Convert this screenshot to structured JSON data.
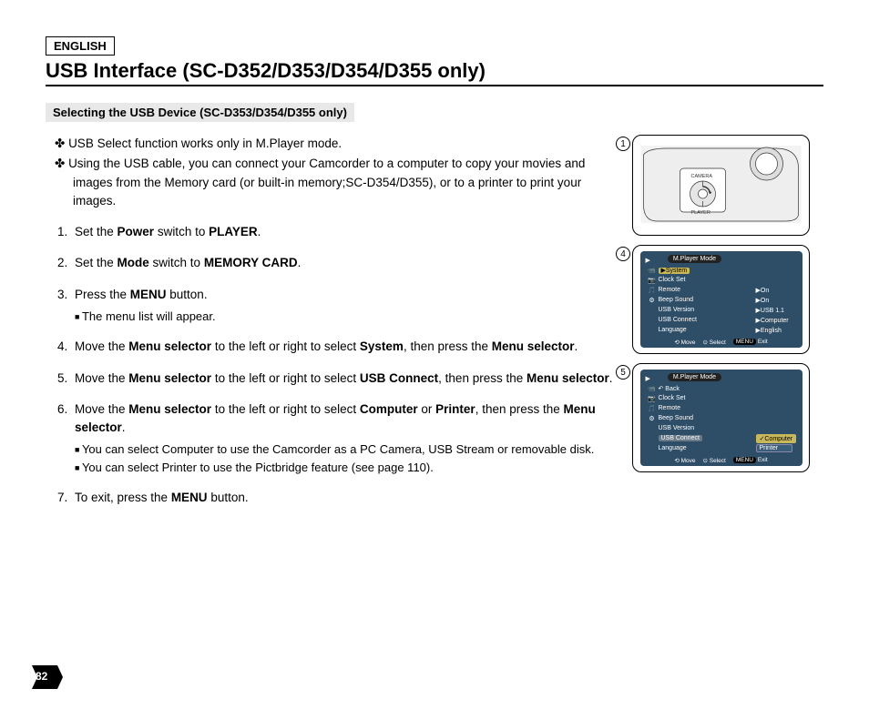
{
  "lang": "ENGLISH",
  "title": "USB Interface (SC-D352/D353/D354/D355 only)",
  "subhead": "Selecting the USB Device (SC-D353/D354/D355 only)",
  "bullets": [
    "USB Select function works only in M.Player mode.",
    "Using the USB cable, you can connect your Camcorder to a computer to copy your movies and images from the Memory card (or built-in memory;SC-D354/D355), or to a printer to print your images."
  ],
  "steps": {
    "s1_a": "Set the ",
    "s1_b": "Power",
    "s1_c": " switch to ",
    "s1_d": "PLAYER",
    "s1_e": ".",
    "s2_a": "Set the ",
    "s2_b": "Mode",
    "s2_c": " switch to ",
    "s2_d": "MEMORY CARD",
    "s2_e": ".",
    "s3_a": "Press the ",
    "s3_b": "MENU",
    "s3_c": " button.",
    "s3_sub1": "The menu list will appear.",
    "s4_a": "Move the ",
    "s4_b": "Menu selector",
    "s4_c": " to the left or right to select ",
    "s4_d": "System",
    "s4_e": ", then press the ",
    "s4_f": "Menu selector",
    "s4_g": ".",
    "s5_a": "Move the ",
    "s5_b": "Menu selector",
    "s5_c": " to the left or right to select ",
    "s5_d": "USB Connect",
    "s5_e": ", then press the ",
    "s5_f": "Menu selector",
    "s5_g": ".",
    "s6_a": "Move the ",
    "s6_b": "Menu selector",
    "s6_c": " to the left or right to select ",
    "s6_d": "Computer",
    "s6_e": " or ",
    "s6_f": "Printer",
    "s6_g": ", then press the ",
    "s6_h": "Menu selector",
    "s6_i": ".",
    "s6_sub1": "You can select Computer to use the Camcorder as a PC Camera, USB Stream or removable disk.",
    "s6_sub2": "You can select Printer to use the Pictbridge feature (see page 110).",
    "s7_a": "To exit, press the ",
    "s7_b": "MENU",
    "s7_c": " button."
  },
  "fig1": {
    "num": "1",
    "label_camera": "CAMERA",
    "label_player": "PLAYER"
  },
  "fig4": {
    "num": "4",
    "title": "M.Player Mode",
    "rows": [
      {
        "icon": "📹",
        "label": "System",
        "val": "",
        "hl": true
      },
      {
        "icon": "📷",
        "label": "Clock Set",
        "val": ""
      },
      {
        "icon": "🎵",
        "label": "Remote",
        "val": "▶On"
      },
      {
        "icon": "⚙",
        "label": "Beep Sound",
        "val": "▶On"
      },
      {
        "icon": "",
        "label": "USB Version",
        "val": "▶USB 1.1"
      },
      {
        "icon": "",
        "label": "USB Connect",
        "val": "▶Computer"
      },
      {
        "icon": "",
        "label": "Language",
        "val": "▶English"
      }
    ],
    "footer": {
      "move": "Move",
      "select": "Select",
      "exit": "Exit",
      "exitbtn": "MENU"
    }
  },
  "fig5": {
    "num": "5",
    "title": "M.Player Mode",
    "rows": [
      {
        "icon": "📹",
        "label": "Back",
        "val": ""
      },
      {
        "icon": "📷",
        "label": "Clock Set",
        "val": ""
      },
      {
        "icon": "🎵",
        "label": "Remote",
        "val": ""
      },
      {
        "icon": "⚙",
        "label": "Beep Sound",
        "val": ""
      },
      {
        "icon": "",
        "label": "USB Version",
        "val": ""
      },
      {
        "icon": "",
        "label": "USB Connect",
        "val": "✓Computer",
        "hl": true,
        "valhl": true
      },
      {
        "icon": "",
        "label": "Language",
        "val": "Printer",
        "valbox": true
      }
    ],
    "footer": {
      "move": "Move",
      "select": "Select",
      "exit": "Exit",
      "exitbtn": "MENU"
    }
  },
  "page_number": "82"
}
